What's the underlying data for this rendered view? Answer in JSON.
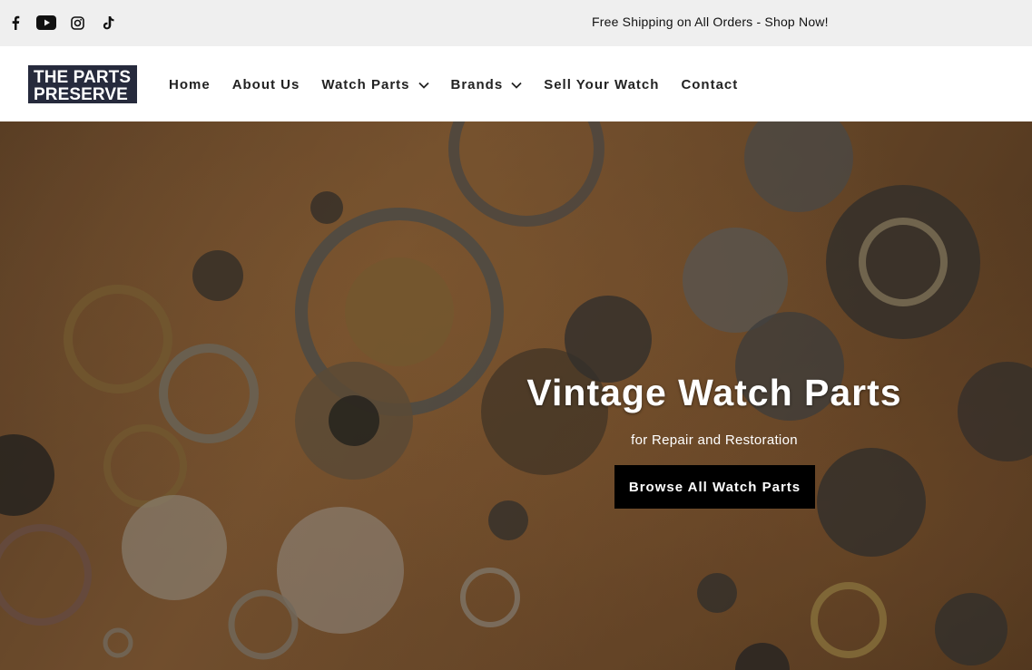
{
  "topbar": {
    "social": [
      "facebook-icon",
      "youtube-icon",
      "instagram-icon",
      "tiktok-icon"
    ],
    "announcement": "Free Shipping on All Orders - Shop Now!"
  },
  "header": {
    "logo_line1": "THE PARTS",
    "logo_line2": "PRESERVE",
    "nav": [
      {
        "label": "Home"
      },
      {
        "label": "About Us"
      },
      {
        "label": "Watch Parts",
        "dropdown": true
      },
      {
        "label": "Brands",
        "dropdown": true
      },
      {
        "label": "Sell Your Watch"
      },
      {
        "label": "Contact"
      }
    ]
  },
  "hero": {
    "title": "Vintage Watch Parts",
    "subtitle": "for Repair and Restoration",
    "button": "Browse All Watch Parts"
  },
  "colors": {
    "topbar_bg": "#efefef",
    "logo_bg": "#262a3c",
    "button_bg": "#000000"
  }
}
